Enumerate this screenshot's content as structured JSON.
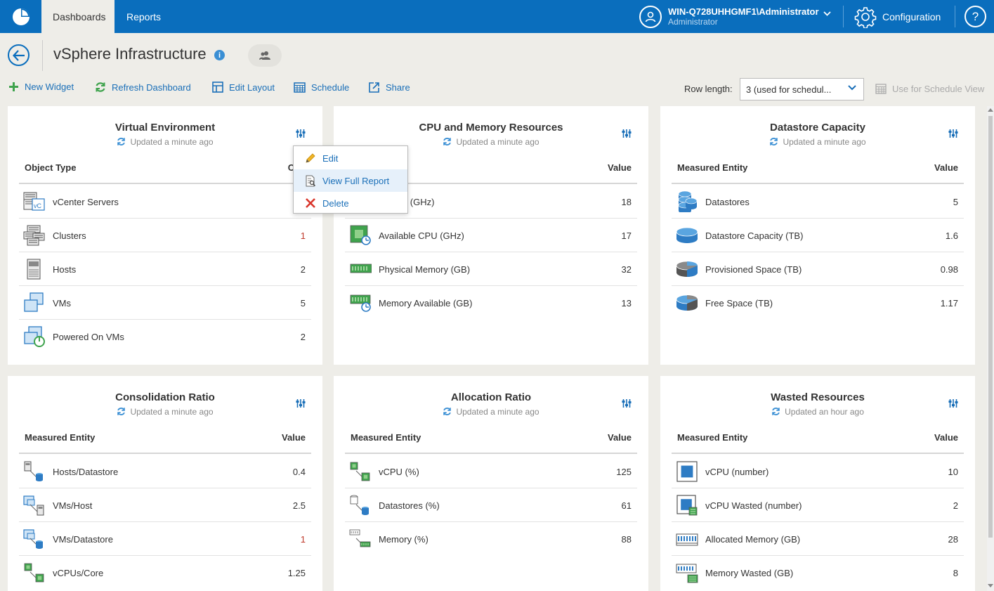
{
  "topbar": {
    "tabs": [
      {
        "label": "Dashboards"
      },
      {
        "label": "Reports"
      }
    ],
    "user": {
      "name": "WIN-Q728UHHGMF1\\Administrator",
      "role": "Administrator"
    },
    "configuration_label": "Configuration",
    "help_label": "?"
  },
  "page": {
    "title": "vSphere Infrastructure",
    "info_glyph": "i"
  },
  "toolbar": {
    "new_widget": "New Widget",
    "refresh_dashboard": "Refresh Dashboard",
    "edit_layout": "Edit Layout",
    "schedule": "Schedule",
    "share": "Share",
    "row_length_label": "Row length:",
    "row_length_value": "3 (used for schedul...",
    "use_for_schedule_view": "Use for Schedule View"
  },
  "context_menu": {
    "items": [
      {
        "label": "Edit"
      },
      {
        "label": "View Full Report"
      },
      {
        "label": "Delete"
      }
    ]
  },
  "widgets": [
    {
      "title": "Virtual Environment",
      "updated": "Updated a minute ago",
      "col1": "Object Type",
      "col2": "Cou",
      "rows": [
        {
          "label": "vCenter Servers",
          "value": "",
          "icon": "vcenter-servers-icon"
        },
        {
          "label": "Clusters",
          "value": "1",
          "icon": "clusters-icon",
          "highlight": true
        },
        {
          "label": "Hosts",
          "value": "2",
          "icon": "hosts-icon"
        },
        {
          "label": "VMs",
          "value": "5",
          "icon": "vms-icon"
        },
        {
          "label": "Powered On VMs",
          "value": "2",
          "icon": "powered-on-vms-icon"
        }
      ]
    },
    {
      "title": "CPU and Memory Resources",
      "updated": "Updated a minute ago",
      "col1": "ntity",
      "col2": "Value",
      "rows": [
        {
          "label": "al CPU (GHz)",
          "value": "18",
          "icon": "total-cpu-icon"
        },
        {
          "label": "Available CPU (GHz)",
          "value": "17",
          "icon": "available-cpu-icon"
        },
        {
          "label": "Physical Memory (GB)",
          "value": "32",
          "icon": "physical-memory-icon"
        },
        {
          "label": "Memory Available (GB)",
          "value": "13",
          "icon": "memory-available-icon"
        }
      ]
    },
    {
      "title": "Datastore Capacity",
      "updated": "Updated a minute ago",
      "col1": "Measured Entity",
      "col2": "Value",
      "rows": [
        {
          "label": "Datastores",
          "value": "5",
          "icon": "datastores-icon"
        },
        {
          "label": "Datastore Capacity (TB)",
          "value": "1.6",
          "icon": "datastore-capacity-icon"
        },
        {
          "label": "Provisioned Space (TB)",
          "value": "0.98",
          "icon": "provisioned-space-icon"
        },
        {
          "label": "Free Space (TB)",
          "value": "1.17",
          "icon": "free-space-icon"
        }
      ]
    },
    {
      "title": "Consolidation Ratio",
      "updated": "Updated a minute ago",
      "col1": "Measured Entity",
      "col2": "Value",
      "rows": [
        {
          "label": "Hosts/Datastore",
          "value": "0.4",
          "icon": "hosts-datastore-icon"
        },
        {
          "label": "VMs/Host",
          "value": "2.5",
          "icon": "vms-host-icon"
        },
        {
          "label": "VMs/Datastore",
          "value": "1",
          "icon": "vms-datastore-icon",
          "highlight": true
        },
        {
          "label": "vCPUs/Core",
          "value": "1.25",
          "icon": "vcpus-core-icon"
        }
      ]
    },
    {
      "title": "Allocation Ratio",
      "updated": "Updated a minute ago",
      "col1": "Measured Entity",
      "col2": "Value",
      "rows": [
        {
          "label": "vCPU (%)",
          "value": "125",
          "icon": "vcpu-percent-icon"
        },
        {
          "label": "Datastores (%)",
          "value": "61",
          "icon": "datastores-percent-icon"
        },
        {
          "label": "Memory (%)",
          "value": "88",
          "icon": "memory-percent-icon"
        }
      ]
    },
    {
      "title": "Wasted Resources",
      "updated": "Updated an hour ago",
      "col1": "Measured Entity",
      "col2": "Value",
      "rows": [
        {
          "label": "vCPU (number)",
          "value": "10",
          "icon": "vcpu-number-icon"
        },
        {
          "label": "vCPU Wasted (number)",
          "value": "2",
          "icon": "vcpu-wasted-icon"
        },
        {
          "label": "Allocated Memory (GB)",
          "value": "28",
          "icon": "allocated-memory-icon"
        },
        {
          "label": "Memory Wasted (GB)",
          "value": "8",
          "icon": "memory-wasted-icon"
        }
      ]
    }
  ],
  "colors": {
    "brand": "#0a6ebd",
    "link": "#1a6fb8",
    "highlight_value": "#c0392b",
    "delete_icon": "#d9352b",
    "chip_green": "#3fa34d"
  }
}
